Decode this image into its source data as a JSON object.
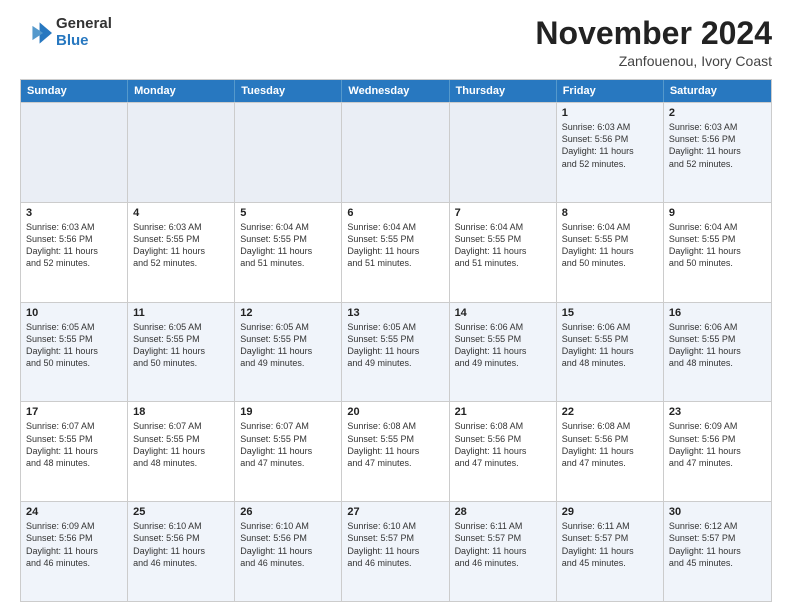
{
  "logo": {
    "general": "General",
    "blue": "Blue"
  },
  "title": "November 2024",
  "location": "Zanfouenou, Ivory Coast",
  "weekdays": [
    "Sunday",
    "Monday",
    "Tuesday",
    "Wednesday",
    "Thursday",
    "Friday",
    "Saturday"
  ],
  "rows": [
    [
      {
        "day": "",
        "info": "",
        "empty": true
      },
      {
        "day": "",
        "info": "",
        "empty": true
      },
      {
        "day": "",
        "info": "",
        "empty": true
      },
      {
        "day": "",
        "info": "",
        "empty": true
      },
      {
        "day": "",
        "info": "",
        "empty": true
      },
      {
        "day": "1",
        "info": "Sunrise: 6:03 AM\nSunset: 5:56 PM\nDaylight: 11 hours\nand 52 minutes."
      },
      {
        "day": "2",
        "info": "Sunrise: 6:03 AM\nSunset: 5:56 PM\nDaylight: 11 hours\nand 52 minutes."
      }
    ],
    [
      {
        "day": "3",
        "info": "Sunrise: 6:03 AM\nSunset: 5:56 PM\nDaylight: 11 hours\nand 52 minutes."
      },
      {
        "day": "4",
        "info": "Sunrise: 6:03 AM\nSunset: 5:55 PM\nDaylight: 11 hours\nand 52 minutes."
      },
      {
        "day": "5",
        "info": "Sunrise: 6:04 AM\nSunset: 5:55 PM\nDaylight: 11 hours\nand 51 minutes."
      },
      {
        "day": "6",
        "info": "Sunrise: 6:04 AM\nSunset: 5:55 PM\nDaylight: 11 hours\nand 51 minutes."
      },
      {
        "day": "7",
        "info": "Sunrise: 6:04 AM\nSunset: 5:55 PM\nDaylight: 11 hours\nand 51 minutes."
      },
      {
        "day": "8",
        "info": "Sunrise: 6:04 AM\nSunset: 5:55 PM\nDaylight: 11 hours\nand 50 minutes."
      },
      {
        "day": "9",
        "info": "Sunrise: 6:04 AM\nSunset: 5:55 PM\nDaylight: 11 hours\nand 50 minutes."
      }
    ],
    [
      {
        "day": "10",
        "info": "Sunrise: 6:05 AM\nSunset: 5:55 PM\nDaylight: 11 hours\nand 50 minutes."
      },
      {
        "day": "11",
        "info": "Sunrise: 6:05 AM\nSunset: 5:55 PM\nDaylight: 11 hours\nand 50 minutes."
      },
      {
        "day": "12",
        "info": "Sunrise: 6:05 AM\nSunset: 5:55 PM\nDaylight: 11 hours\nand 49 minutes."
      },
      {
        "day": "13",
        "info": "Sunrise: 6:05 AM\nSunset: 5:55 PM\nDaylight: 11 hours\nand 49 minutes."
      },
      {
        "day": "14",
        "info": "Sunrise: 6:06 AM\nSunset: 5:55 PM\nDaylight: 11 hours\nand 49 minutes."
      },
      {
        "day": "15",
        "info": "Sunrise: 6:06 AM\nSunset: 5:55 PM\nDaylight: 11 hours\nand 48 minutes."
      },
      {
        "day": "16",
        "info": "Sunrise: 6:06 AM\nSunset: 5:55 PM\nDaylight: 11 hours\nand 48 minutes."
      }
    ],
    [
      {
        "day": "17",
        "info": "Sunrise: 6:07 AM\nSunset: 5:55 PM\nDaylight: 11 hours\nand 48 minutes."
      },
      {
        "day": "18",
        "info": "Sunrise: 6:07 AM\nSunset: 5:55 PM\nDaylight: 11 hours\nand 48 minutes."
      },
      {
        "day": "19",
        "info": "Sunrise: 6:07 AM\nSunset: 5:55 PM\nDaylight: 11 hours\nand 47 minutes."
      },
      {
        "day": "20",
        "info": "Sunrise: 6:08 AM\nSunset: 5:55 PM\nDaylight: 11 hours\nand 47 minutes."
      },
      {
        "day": "21",
        "info": "Sunrise: 6:08 AM\nSunset: 5:56 PM\nDaylight: 11 hours\nand 47 minutes."
      },
      {
        "day": "22",
        "info": "Sunrise: 6:08 AM\nSunset: 5:56 PM\nDaylight: 11 hours\nand 47 minutes."
      },
      {
        "day": "23",
        "info": "Sunrise: 6:09 AM\nSunset: 5:56 PM\nDaylight: 11 hours\nand 47 minutes."
      }
    ],
    [
      {
        "day": "24",
        "info": "Sunrise: 6:09 AM\nSunset: 5:56 PM\nDaylight: 11 hours\nand 46 minutes."
      },
      {
        "day": "25",
        "info": "Sunrise: 6:10 AM\nSunset: 5:56 PM\nDaylight: 11 hours\nand 46 minutes."
      },
      {
        "day": "26",
        "info": "Sunrise: 6:10 AM\nSunset: 5:56 PM\nDaylight: 11 hours\nand 46 minutes."
      },
      {
        "day": "27",
        "info": "Sunrise: 6:10 AM\nSunset: 5:57 PM\nDaylight: 11 hours\nand 46 minutes."
      },
      {
        "day": "28",
        "info": "Sunrise: 6:11 AM\nSunset: 5:57 PM\nDaylight: 11 hours\nand 46 minutes."
      },
      {
        "day": "29",
        "info": "Sunrise: 6:11 AM\nSunset: 5:57 PM\nDaylight: 11 hours\nand 45 minutes."
      },
      {
        "day": "30",
        "info": "Sunrise: 6:12 AM\nSunset: 5:57 PM\nDaylight: 11 hours\nand 45 minutes."
      }
    ]
  ],
  "alt_rows": [
    0,
    2,
    4
  ]
}
